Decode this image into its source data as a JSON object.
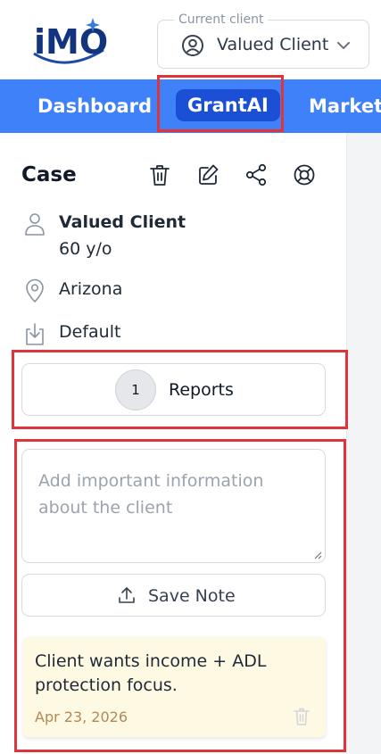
{
  "brand": {
    "logo_text": "iMO"
  },
  "client_selector": {
    "caption": "Current client",
    "value": "Valued Client"
  },
  "nav": {
    "items": [
      "Dashboard",
      "GrantAI",
      "Marketp"
    ],
    "active": "GrantAI"
  },
  "case": {
    "title": "Case",
    "client_name": "Valued Client",
    "age": "60 y/o",
    "state": "Arizona",
    "plan": "Default"
  },
  "reports": {
    "count": "1",
    "label": "Reports"
  },
  "notes": {
    "placeholder": "Add important information about the client",
    "save_label": "Save Note",
    "items": [
      {
        "text": "Client wants income + ADL protection focus.",
        "date": "Apr 23, 2026"
      }
    ]
  },
  "colors": {
    "accent": "#3f81f8",
    "active_tab": "#1a4fd6",
    "highlight": "#e0333b",
    "note_bg": "#fef9e3"
  }
}
